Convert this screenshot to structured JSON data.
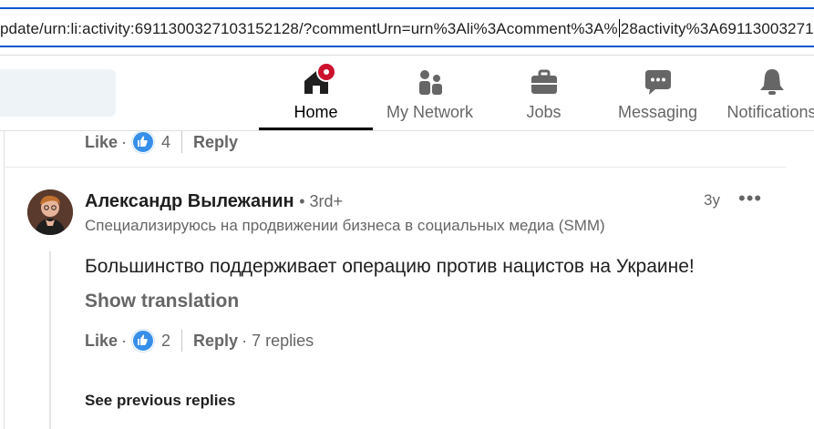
{
  "browser": {
    "url": "pdate/urn:li:activity:6911300327103152128/?commentUrn=urn%3Ali%3Acomment%3A%",
    "url_tail": "28activity%3A69113003271"
  },
  "nav": {
    "items": [
      {
        "label": "Home",
        "icon": "home-icon",
        "active": true
      },
      {
        "label": "My Network",
        "icon": "network-icon"
      },
      {
        "label": "Jobs",
        "icon": "briefcase-icon"
      },
      {
        "label": "Messaging",
        "icon": "messaging-icon"
      },
      {
        "label": "Notifications",
        "icon": "bell-icon"
      }
    ],
    "accent": "#cb112d"
  },
  "prev_comment": {
    "like_label": "Like",
    "reaction_count": "4",
    "reply_label": "Reply"
  },
  "comment": {
    "author": "Александр Вылежанин",
    "degree": "• 3rd+",
    "headline": "Специализируюсь на продвижении бизнеса в социальных медиа (SMM)",
    "time": "3y",
    "more": "•••",
    "text": "Большинство поддерживает операцию против нацистов на Украине!",
    "translate_label": "Show translation",
    "like_label": "Like",
    "reaction_count": "2",
    "reply_label": "Reply",
    "replies_label": "· 7 replies"
  },
  "see_previous_replies": "See previous replies",
  "colors": {
    "link_blue": "#0b57d0",
    "reaction_blue": "#378fe9",
    "muted_text": "#666666"
  }
}
